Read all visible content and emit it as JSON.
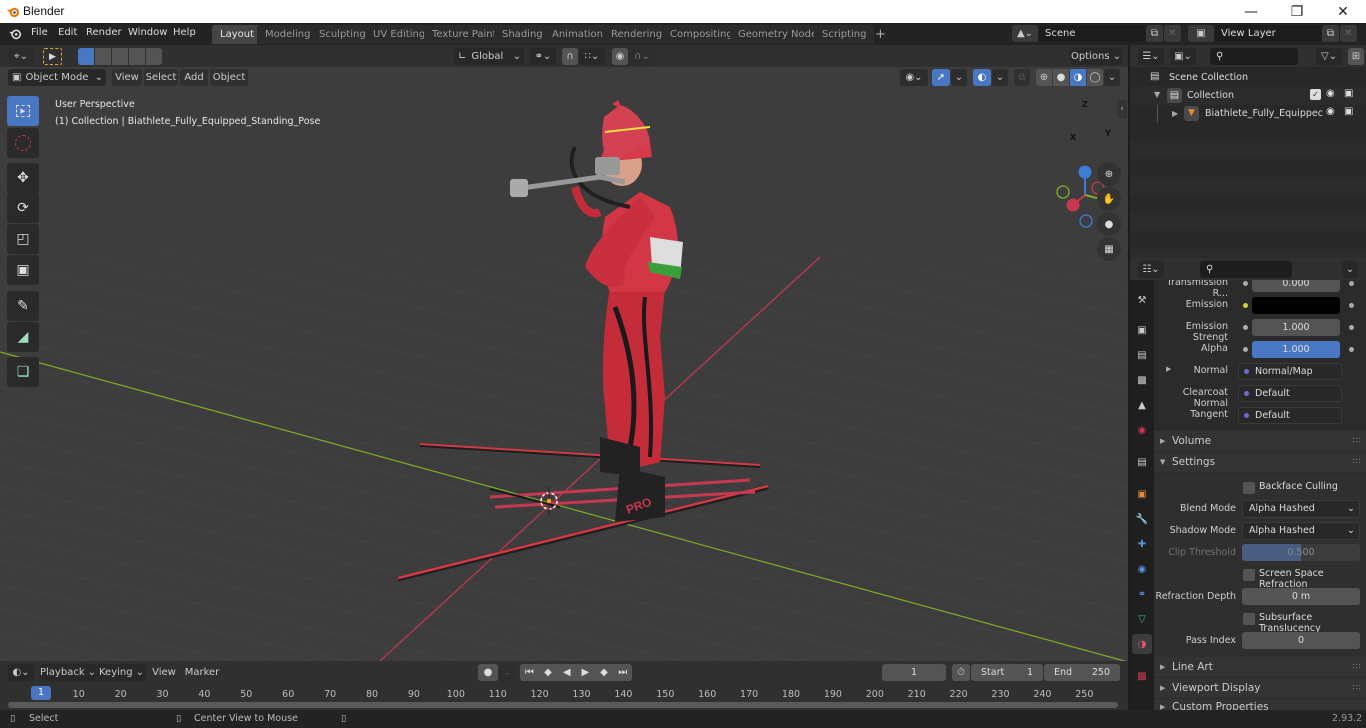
{
  "window": {
    "title": "Blender",
    "controls": [
      "minimize",
      "maximize",
      "close"
    ]
  },
  "menu": [
    "File",
    "Edit",
    "Render",
    "Window",
    "Help"
  ],
  "workspace_tabs": [
    {
      "label": "Layout",
      "active": true
    },
    {
      "label": "Modeling"
    },
    {
      "label": "Sculpting"
    },
    {
      "label": "UV Editing"
    },
    {
      "label": "Texture Paint"
    },
    {
      "label": "Shading"
    },
    {
      "label": "Animation"
    },
    {
      "label": "Rendering"
    },
    {
      "label": "Compositing"
    },
    {
      "label": "Geometry Nodes"
    },
    {
      "label": "Scripting"
    }
  ],
  "add_workspace": "+",
  "scene": {
    "value": "Scene"
  },
  "view_layer": {
    "value": "View Layer"
  },
  "tool_header": {
    "transform_orientation": "Global",
    "options_label": "Options"
  },
  "viewport_header": {
    "mode": "Object Mode",
    "menus": [
      "View",
      "Select",
      "Add",
      "Object"
    ]
  },
  "viewport": {
    "perspective_label": "User Perspective",
    "object_label": "(1) Collection | Biathlete_Fully_Equipped_Standing_Pose",
    "gizmo": {
      "x": "X",
      "y": "Y",
      "z": "Z"
    },
    "colors": {
      "x_axis": "#c8394f",
      "y_axis": "#7fae2a",
      "z_axis": "#3d7dd6",
      "background": "#3d3d3d"
    }
  },
  "tools": [
    "select-box",
    "cursor",
    "move",
    "rotate",
    "scale",
    "transform",
    "annotate",
    "measure",
    "add-cube"
  ],
  "outliner": {
    "root": "Scene Collection",
    "items": [
      {
        "label": "Collection",
        "level": 1,
        "expanded": true
      },
      {
        "label": "Biathlete_Fully_Equippec",
        "level": 2,
        "expanded": false
      }
    ]
  },
  "properties": {
    "rows": [
      {
        "label": "Transmission R...",
        "value": "0.000",
        "type": "number"
      },
      {
        "label": "Emission",
        "value": "",
        "type": "color"
      },
      {
        "label": "Emission Strengt",
        "value": "1.000",
        "type": "number"
      },
      {
        "label": "Alpha",
        "value": "1.000",
        "type": "slider",
        "fraction": 1.0
      },
      {
        "label": "Normal",
        "value": "Normal/Map",
        "type": "link"
      },
      {
        "label": "Clearcoat Normal",
        "value": "Default",
        "type": "link"
      },
      {
        "label": "Tangent",
        "value": "Default",
        "type": "link"
      }
    ],
    "sections": {
      "volume": "Volume",
      "settings": "Settings",
      "line_art": "Line Art",
      "viewport_display": "Viewport Display",
      "custom_properties": "Custom Properties"
    },
    "settings": {
      "backface_culling": {
        "label": "Backface Culling",
        "checked": false
      },
      "blend_mode": {
        "label": "Blend Mode",
        "value": "Alpha Hashed"
      },
      "shadow_mode": {
        "label": "Shadow Mode",
        "value": "Alpha Hashed"
      },
      "clip_threshold": {
        "label": "Clip Threshold",
        "value": "0.500",
        "fraction": 0.5
      },
      "screen_space_refraction": {
        "label": "Screen Space Refraction",
        "checked": false
      },
      "refraction_depth": {
        "label": "Refraction Depth",
        "value": "0 m"
      },
      "subsurface_translucency": {
        "label": "Subsurface Translucency",
        "checked": false
      },
      "pass_index": {
        "label": "Pass Index",
        "value": "0"
      }
    }
  },
  "timeline": {
    "menus": [
      "Playback",
      "Keying",
      "View",
      "Marker"
    ],
    "current_frame": "1",
    "start_label": "Start",
    "start": "1",
    "end_label": "End",
    "end": "250",
    "ticks": [
      "10",
      "20",
      "30",
      "40",
      "50",
      "60",
      "70",
      "80",
      "90",
      "100",
      "110",
      "120",
      "130",
      "140",
      "150",
      "160",
      "170",
      "180",
      "190",
      "200",
      "210",
      "220",
      "230",
      "240",
      "250"
    ],
    "playhead": "1"
  },
  "statusbar": {
    "left_action": "Select",
    "middle_action": "Center View to Mouse",
    "version": "2.93.2"
  }
}
